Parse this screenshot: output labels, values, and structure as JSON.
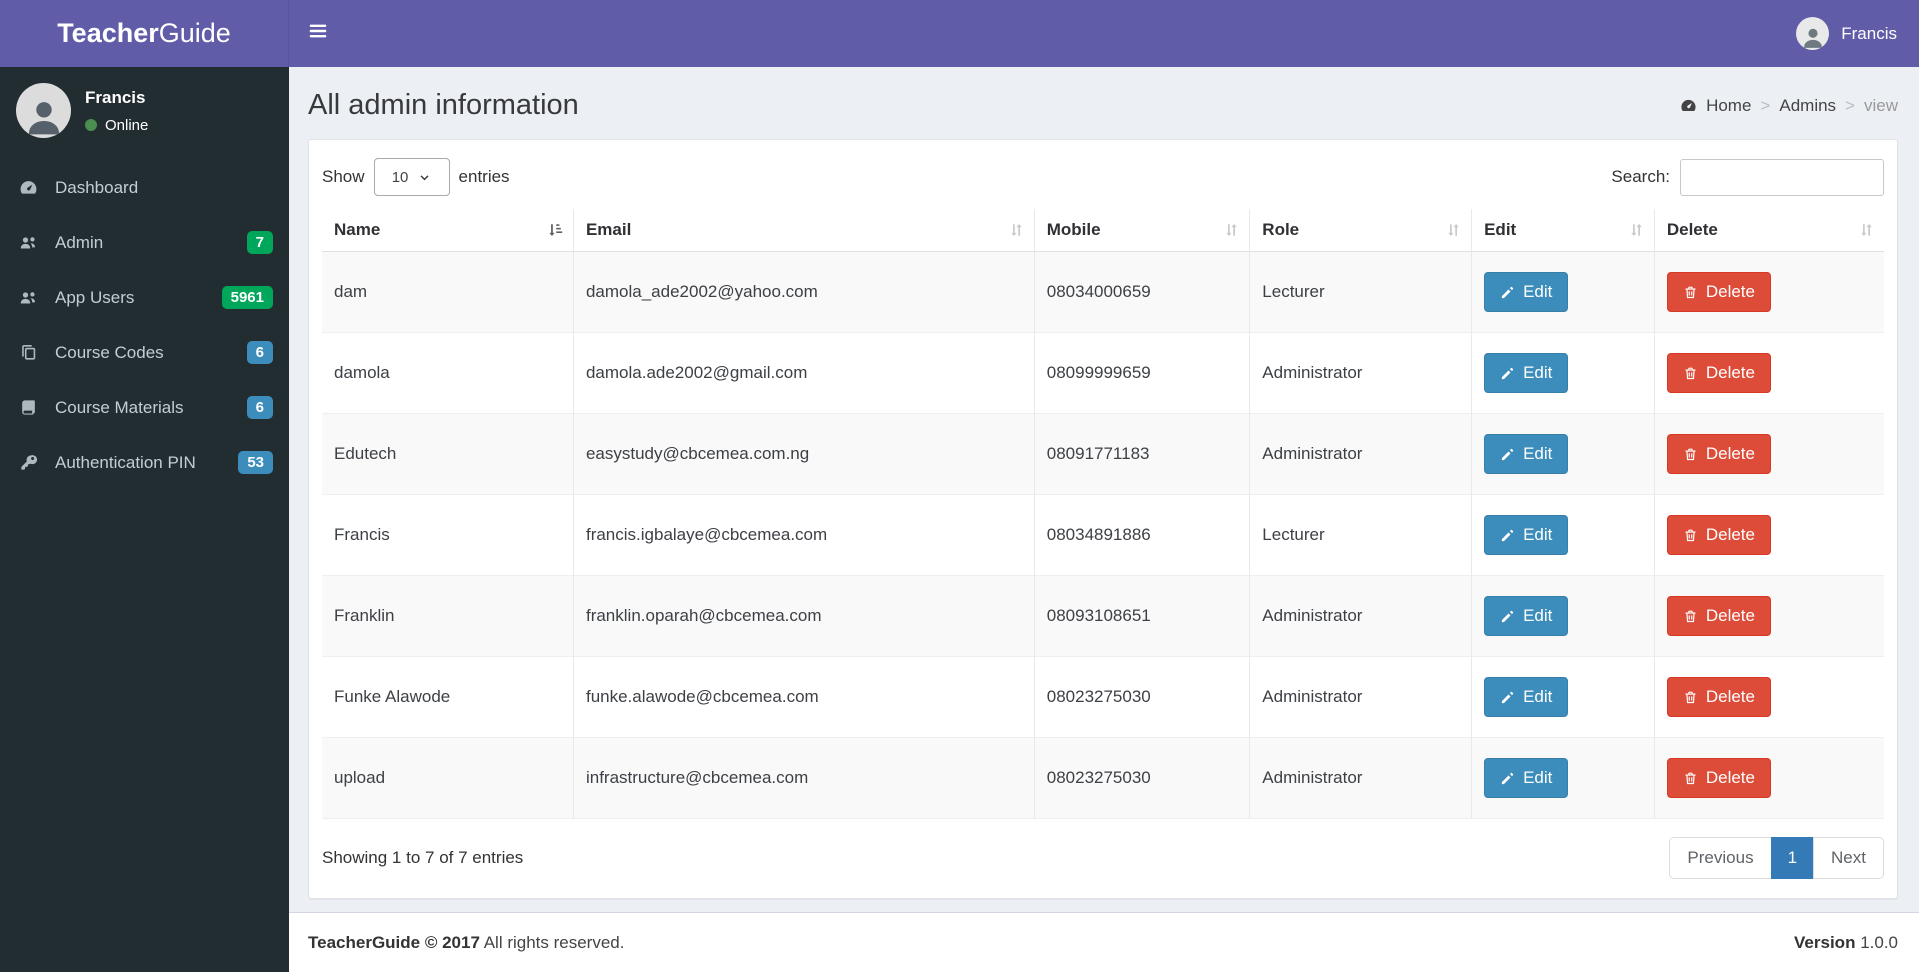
{
  "app": {
    "brand_bold": "Teacher",
    "brand_light": "Guide"
  },
  "navbar": {
    "user_name": "Francis"
  },
  "sidebar": {
    "user": {
      "name": "Francis",
      "status": "Online"
    },
    "items": [
      {
        "label": "Dashboard",
        "icon": "dashboard",
        "badge": null
      },
      {
        "label": "Admin",
        "icon": "users",
        "badge": "7",
        "badge_color": "#00a65a"
      },
      {
        "label": "App Users",
        "icon": "users",
        "badge": "5961",
        "badge_color": "#00a65a"
      },
      {
        "label": "Course Codes",
        "icon": "copy",
        "badge": "6",
        "badge_color": "#3c8dbc"
      },
      {
        "label": "Course Materials",
        "icon": "book",
        "badge": "6",
        "badge_color": "#3c8dbc"
      },
      {
        "label": "Authentication PIN",
        "icon": "key",
        "badge": "53",
        "badge_color": "#3c8dbc"
      }
    ]
  },
  "content": {
    "title": "All admin information",
    "breadcrumb": {
      "home": "Home",
      "section": "Admins",
      "current": "view",
      "sep": ">"
    }
  },
  "controls": {
    "show_label": "Show",
    "entries_label": "entries",
    "page_size": "10",
    "search_label": "Search:",
    "search_value": ""
  },
  "table": {
    "columns": [
      "Name",
      "Email",
      "Mobile",
      "Role",
      "Edit",
      "Delete"
    ],
    "edit_label": "Edit",
    "delete_label": "Delete",
    "rows": [
      {
        "name": "dam",
        "email": "damola_ade2002@yahoo.com",
        "mobile": "08034000659",
        "role": "Lecturer"
      },
      {
        "name": "damola",
        "email": "damola.ade2002@gmail.com",
        "mobile": "08099999659",
        "role": "Administrator"
      },
      {
        "name": "Edutech",
        "email": "easystudy@cbcemea.com.ng",
        "mobile": "08091771183",
        "role": "Administrator"
      },
      {
        "name": "Francis",
        "email": "francis.igbalaye@cbcemea.com",
        "mobile": "08034891886",
        "role": "Lecturer"
      },
      {
        "name": "Franklin",
        "email": "franklin.oparah@cbcemea.com",
        "mobile": "08093108651",
        "role": "Administrator"
      },
      {
        "name": "Funke Alawode",
        "email": "funke.alawode@cbcemea.com",
        "mobile": "08023275030",
        "role": "Administrator"
      },
      {
        "name": "upload",
        "email": "infrastructure@cbcemea.com",
        "mobile": "08023275030",
        "role": "Administrator"
      }
    ]
  },
  "summary": {
    "text": "Showing 1 to 7 of 7 entries"
  },
  "pagination": {
    "previous": "Previous",
    "current": "1",
    "next": "Next"
  },
  "footer": {
    "brand": "TeacherGuide © 2017",
    "rights": "All rights reserved.",
    "version_label": "Version",
    "version_value": "1.0.0"
  },
  "colors": {
    "navbar_purple": "#605ca8",
    "sidebar_dark": "#222d32",
    "badge_green": "#00a65a",
    "badge_blue": "#3c8dbc",
    "edit_button": "#3c8dbc",
    "delete_button": "#dd4b39",
    "pagination_active": "#337ab7",
    "online_dot": "#4a8f4f",
    "content_bg": "#ecf0f5"
  }
}
